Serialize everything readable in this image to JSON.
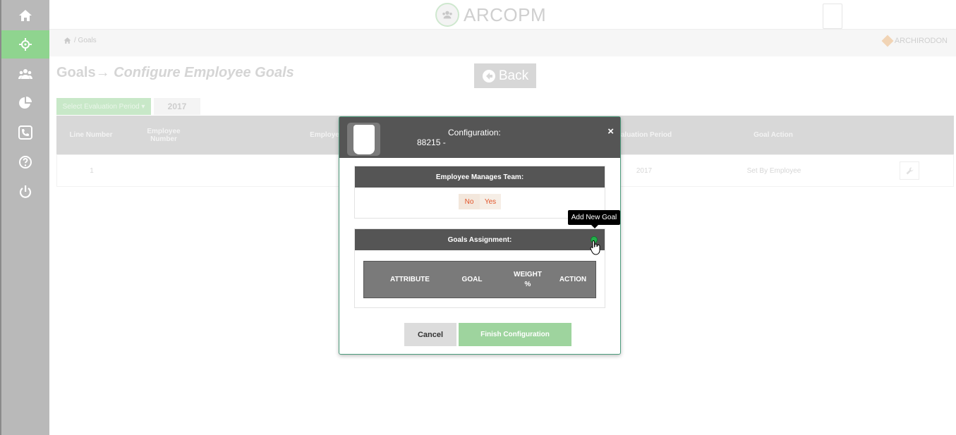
{
  "app": {
    "logo_text": "ARCOPM",
    "brand_text": "ARCHIRODON"
  },
  "breadcrumb": {
    "separator_label": "/ Goals"
  },
  "page": {
    "title_main": "Goals→",
    "title_sub": "Configure Employee Goals",
    "back_label": "Back"
  },
  "period": {
    "button_label": "Select Evaluation Period ▾",
    "value": "2017"
  },
  "table": {
    "headers": {
      "line_number": "Line Number",
      "employee_number": "Employee Number",
      "employee": "Employe",
      "evaluation_period": "aluation Period",
      "goal_action": "Goal Action"
    },
    "row": {
      "line_number": "1",
      "evaluation_period": "2017",
      "goal_action": "Set By Employee"
    }
  },
  "modal": {
    "title": "Configuration:",
    "subtitle": "88215 -",
    "close": "×",
    "manages_team": {
      "heading": "Employee Manages Team:",
      "no": "No",
      "yes": "Yes"
    },
    "goals": {
      "heading": "Goals Assignment:",
      "tooltip": "Add New Goal",
      "columns": [
        "ATTRIBUTE",
        "GOAL",
        "WEIGHT %",
        "ACTION"
      ]
    },
    "cancel_label": "Cancel",
    "finish_label": "Finish Configuration"
  },
  "icons": {
    "sidebar": [
      "home-icon",
      "crosshair-icon",
      "users-icon",
      "pie-chart-icon",
      "phone-icon",
      "help-icon",
      "power-icon"
    ],
    "active_item": "crosshair-icon"
  },
  "colors": {
    "accent_green": "#8fd48f",
    "modal_header": "#555555",
    "toggle_text": "#e2552a"
  }
}
